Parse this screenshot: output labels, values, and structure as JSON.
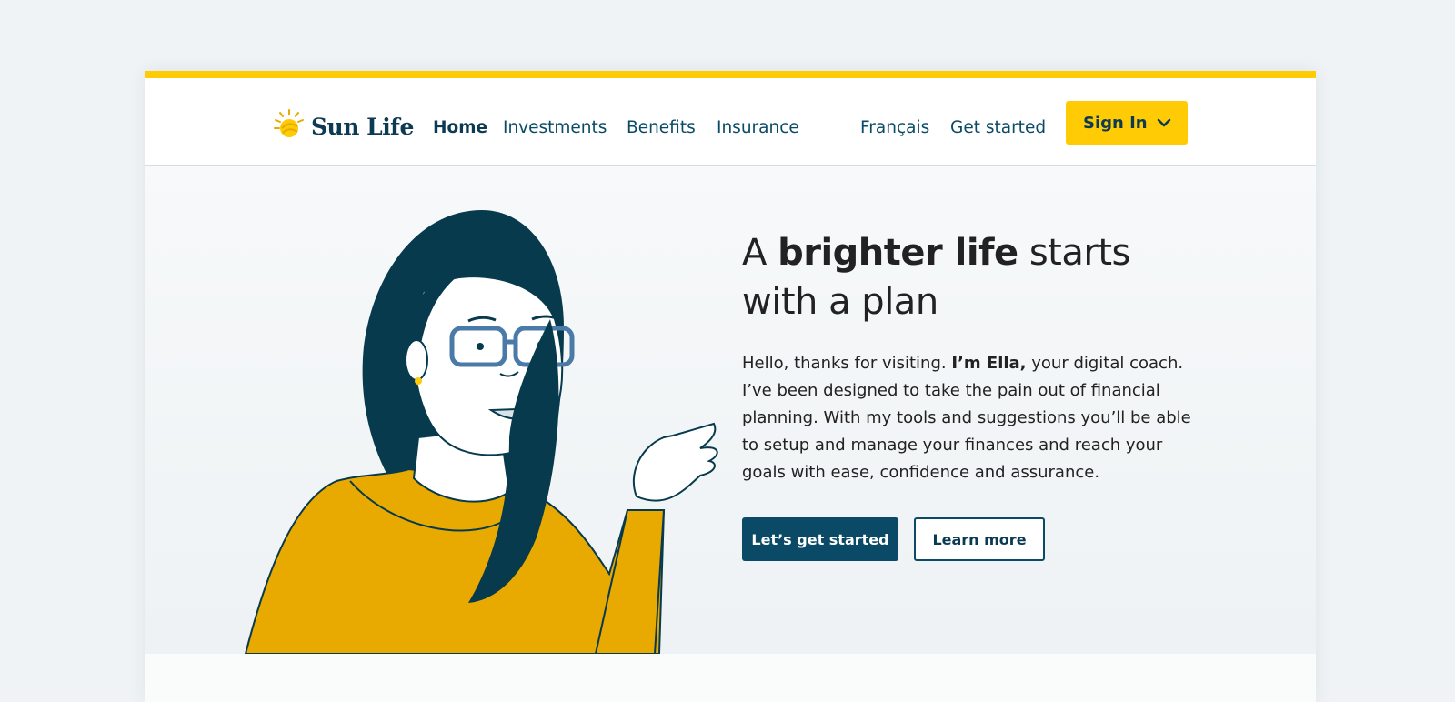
{
  "colors": {
    "accent_yellow": "#ffcb05",
    "brand_navy": "#0b4a66",
    "page_background": "#eff3f5",
    "illustration_shirt": "#e8a900"
  },
  "header": {
    "logo_text": "Sun Life",
    "logo_icon": "sun-icon",
    "nav": [
      {
        "label": "Home",
        "active": true
      },
      {
        "label": "Investments"
      },
      {
        "label": "Benefits"
      },
      {
        "label": "Insurance"
      }
    ],
    "language_link": "Français",
    "get_started_link": "Get started",
    "signin": {
      "label": "Sign In",
      "icon": "chevron-down-icon"
    }
  },
  "hero": {
    "title_part1": "A ",
    "title_bold": "brighter life",
    "title_part2": " starts with a plan",
    "body_part1": "Hello, thanks for visiting. ",
    "body_bold": "I’m Ella,",
    "body_part2": " your digital coach. I’ve been designed to take the pain out of financial planning. With my tools and suggestions you’ll be able to setup and manage your finances and reach your goals with ease, confidence and assurance.",
    "primary_button": "Let’s get started",
    "secondary_button": "Learn more",
    "illustration": "ella-coach-illustration"
  }
}
